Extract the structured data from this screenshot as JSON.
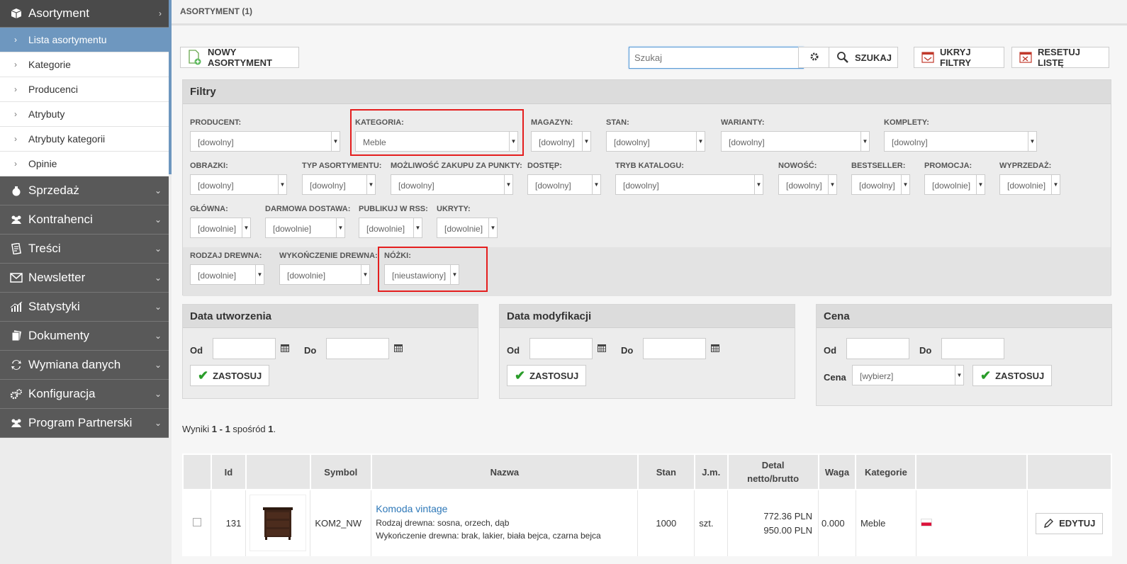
{
  "sidebar": {
    "header": "Asortyment",
    "subitems": [
      "Lista asortymentu",
      "Kategorie",
      "Producenci",
      "Atrybuty",
      "Atrybuty kategorii",
      "Opinie"
    ],
    "sections": [
      "Sprzedaż",
      "Kontrahenci",
      "Treści",
      "Newsletter",
      "Statystyki",
      "Dokumenty",
      "Wymiana danych",
      "Konfiguracja",
      "Program Partnerski"
    ]
  },
  "page_title": "ASORTYMENT (1)",
  "toolbar": {
    "new_label": "NOWY ASORTYMENT",
    "search_placeholder": "Szukaj",
    "search_label": "SZUKAJ",
    "hide_filters_label": "UKRYJ FILTRY",
    "reset_label": "RESETUJ LISTĘ"
  },
  "filters": {
    "title": "Filtry",
    "producent": {
      "label": "PRODUCENT:",
      "value": "[dowolny]"
    },
    "kategoria": {
      "label": "KATEGORIA:",
      "value": "Meble"
    },
    "magazyn": {
      "label": "MAGAZYN:",
      "value": "[dowolny]"
    },
    "stan": {
      "label": "STAN:",
      "value": "[dowolny]"
    },
    "warianty": {
      "label": "WARIANTY:",
      "value": "[dowolny]"
    },
    "komplety": {
      "label": "KOMPLETY:",
      "value": "[dowolny]"
    },
    "obrazki": {
      "label": "OBRAZKI:",
      "value": "[dowolny]"
    },
    "typ": {
      "label": "TYP ASORTYMENTU:",
      "value": "[dowolny]"
    },
    "punkty": {
      "label": "MOŻLIWOŚĆ ZAKUPU ZA PUNKTY:",
      "value": "[dowolny]"
    },
    "dostep": {
      "label": "DOSTĘP:",
      "value": "[dowolny]"
    },
    "tryb": {
      "label": "TRYB KATALOGU:",
      "value": "[dowolny]"
    },
    "nowosc": {
      "label": "NOWOŚĆ:",
      "value": "[dowolny]"
    },
    "bestseller": {
      "label": "BESTSELLER:",
      "value": "[dowolny]"
    },
    "promocja": {
      "label": "PROMOCJA:",
      "value": "[dowolnie]"
    },
    "wyprzedaz": {
      "label": "WYPRZEDAŻ:",
      "value": "[dowolnie]"
    },
    "glowna": {
      "label": "GŁÓWNA:",
      "value": "[dowolnie]"
    },
    "darmowa": {
      "label": "DARMOWA DOSTAWA:",
      "value": "[dowolnie]"
    },
    "rss": {
      "label": "PUBLIKUJ W RSS:",
      "value": "[dowolnie]"
    },
    "ukryty": {
      "label": "UKRYTY:",
      "value": "[dowolnie]"
    },
    "rodzaj": {
      "label": "RODZAJ DREWNA:",
      "value": "[dowolnie]"
    },
    "wykonczenie": {
      "label": "WYKOŃCZENIE DREWNA:",
      "value": "[dowolnie]"
    },
    "nozki": {
      "label": "NÓŻKI:",
      "value": "[nieustawiony]"
    }
  },
  "date_created": {
    "title": "Data utworzenia",
    "from": "Od",
    "to": "Do",
    "apply": "ZASTOSUJ"
  },
  "date_modified": {
    "title": "Data modyfikacji",
    "from": "Od",
    "to": "Do",
    "apply": "ZASTOSUJ"
  },
  "price": {
    "title": "Cena",
    "from": "Od",
    "to": "Do",
    "label": "Cena",
    "select": "[wybierz]",
    "apply": "ZASTOSUJ"
  },
  "results": {
    "prefix": "Wyniki ",
    "range": "1 - 1",
    "mid": " spośród ",
    "total": "1",
    "suffix": "."
  },
  "table": {
    "headers": {
      "id": "Id",
      "symbol": "Symbol",
      "name": "Nazwa",
      "stan": "Stan",
      "jm": "J.m.",
      "detal1": "Detal",
      "detal2": "netto/brutto",
      "waga": "Waga",
      "kategorie": "Kategorie"
    },
    "rows": [
      {
        "id": "131",
        "symbol": "KOM2_NW",
        "name": "Komoda vintage",
        "attr1": "Rodzaj drewna: sosna, orzech, dąb",
        "attr2": "Wykończenie drewna: brak, lakier, biała bejca, czarna bejca",
        "stan": "1000",
        "jm": "szt.",
        "netto": "772.36 PLN",
        "brutto": "950.00 PLN",
        "waga": "0.000",
        "kategoria": "Meble",
        "edit": "EDYTUJ"
      }
    ]
  }
}
